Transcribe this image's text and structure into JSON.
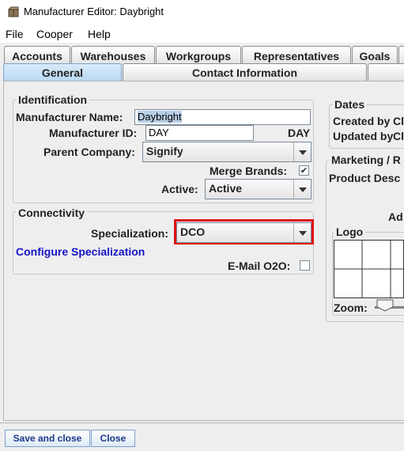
{
  "window": {
    "title": "Manufacturer Editor: Daybright",
    "icon": "package-icon"
  },
  "menu": [
    "File",
    "Cooper",
    "Help"
  ],
  "tabs_top": [
    "Accounts",
    "Warehouses",
    "Workgroups",
    "Representatives",
    "Goals"
  ],
  "tabs_sub": [
    "General",
    "Contact Information"
  ],
  "identification": {
    "title": "Identification",
    "name_label": "Manufacturer Name:",
    "name_value": "Daybright",
    "id_label": "Manufacturer ID:",
    "id_value": "DAY",
    "id_display": "DAY",
    "parent_label": "Parent Company:",
    "parent_value": "Signify",
    "merge_label": "Merge Brands:",
    "merge_checked": true,
    "active_label": "Active:",
    "active_value": "Active"
  },
  "connectivity": {
    "title": "Connectivity",
    "spec_label": "Specialization:",
    "spec_value": "DCO",
    "configure_link": "Configure Specialization",
    "email_label": "E-Mail O2O:",
    "email_checked": false
  },
  "dates": {
    "title": "Dates",
    "created_label": "Created by",
    "created_value": "Cl",
    "updated_label": "Updated by",
    "updated_value": "Cl"
  },
  "marketing": {
    "title": "Marketing / R",
    "product_desc_label": "Product Desc",
    "ad_label": "Ad",
    "logo_title": "Logo",
    "zoom_label": "Zoom:"
  },
  "footer": {
    "save_close": "Save and close",
    "close": "Close"
  }
}
